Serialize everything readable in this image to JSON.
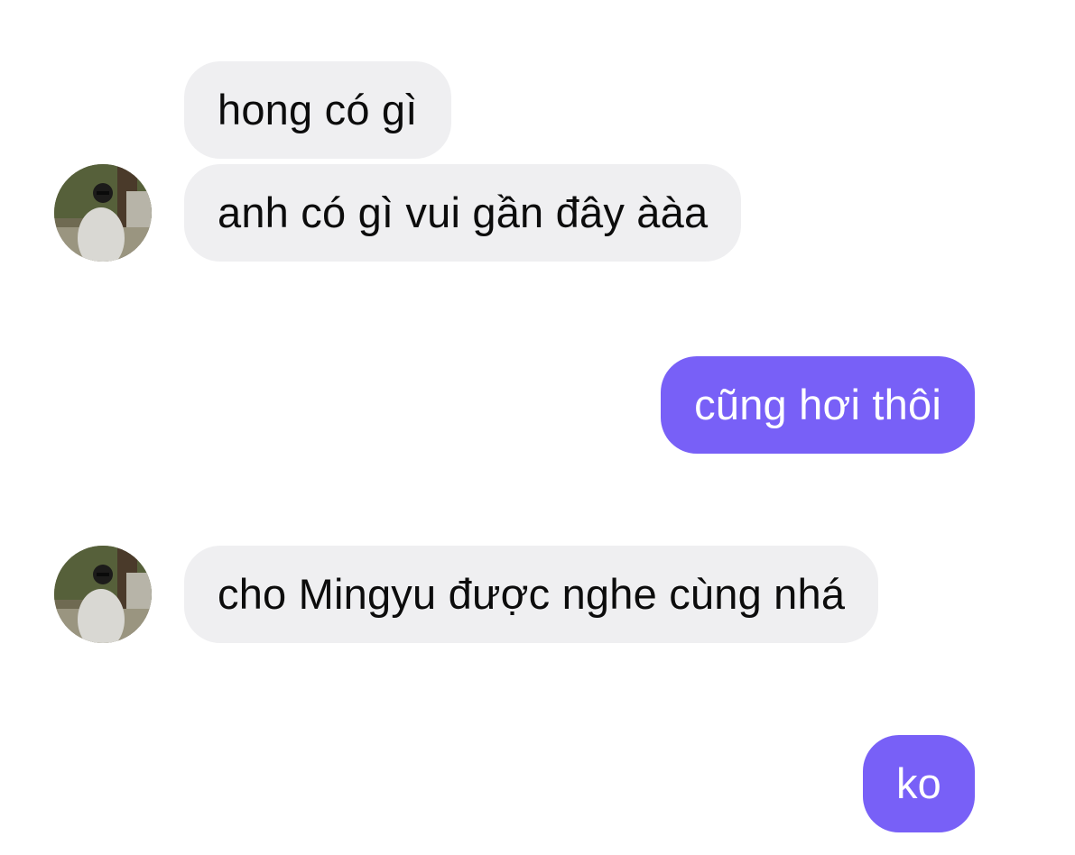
{
  "conversation": {
    "messages": [
      {
        "sender": "other",
        "text": "hong có gì"
      },
      {
        "sender": "other",
        "text": "anh có gì vui gần đây ààa"
      },
      {
        "sender": "me",
        "text": "cũng hơi thôi"
      },
      {
        "sender": "other",
        "text": "cho Mingyu được nghe cùng nhá"
      },
      {
        "sender": "me",
        "text": "ko"
      }
    ]
  },
  "colors": {
    "incoming_bubble": "#efeff1",
    "outgoing_bubble": "#7860f7",
    "incoming_text": "#0c0c0c",
    "outgoing_text": "#ffffff"
  },
  "icons": {
    "avatar": "contact-photo-avatar"
  }
}
